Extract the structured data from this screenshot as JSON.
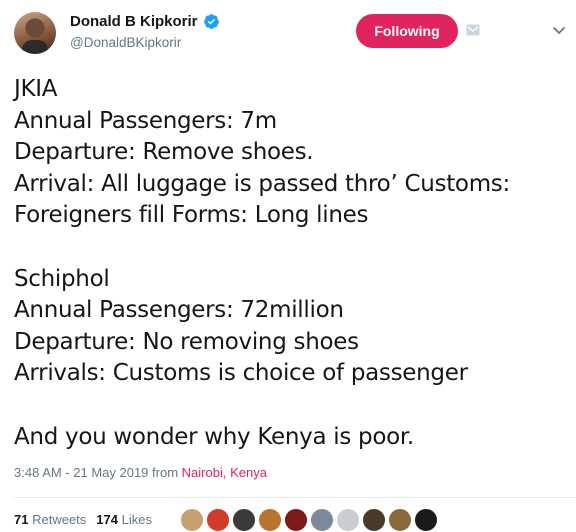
{
  "author": {
    "display_name": "Donald B Kipkorir",
    "handle": "@DonaldBKipkorir",
    "verified": true
  },
  "follow_button": {
    "label": "Following",
    "color": "#e0245e"
  },
  "icons": {
    "avatar": "profile-photo",
    "verified": "verified-badge-icon",
    "blocked": "email-icon",
    "menu": "chevron-down-icon"
  },
  "tweet": {
    "lines": [
      "JKIA",
      "Annual Passengers: 7m",
      "Departure: Remove shoes.",
      "Arrival: All luggage is passed thro’ Customs:",
      "Foreigners fill Forms: Long lines",
      "",
      "Schiphol",
      "Annual Passengers: 72million",
      "Departure: No removing shoes",
      "Arrivals: Customs is choice of passenger",
      "",
      "And you wonder why Kenya is poor."
    ]
  },
  "meta": {
    "time": "3:48 AM - 21 May 2019 from",
    "location": "Nairobi, Kenya"
  },
  "stats": {
    "retweets_count": "71",
    "retweets_label": "Retweets",
    "likes_count": "174",
    "likes_label": "Likes"
  },
  "liker_avatars": [
    "#c8a070",
    "#d23a2a",
    "#3a3a3a",
    "#b8742c",
    "#7a1a1a",
    "#7a8a9a",
    "#c9ccd2",
    "#4a3a2a",
    "#8a6a3a",
    "#1a1a1a"
  ],
  "colors": {
    "text": "#14171a",
    "muted": "#657786",
    "accent": "#e0245e",
    "verified": "#1da1f2"
  }
}
